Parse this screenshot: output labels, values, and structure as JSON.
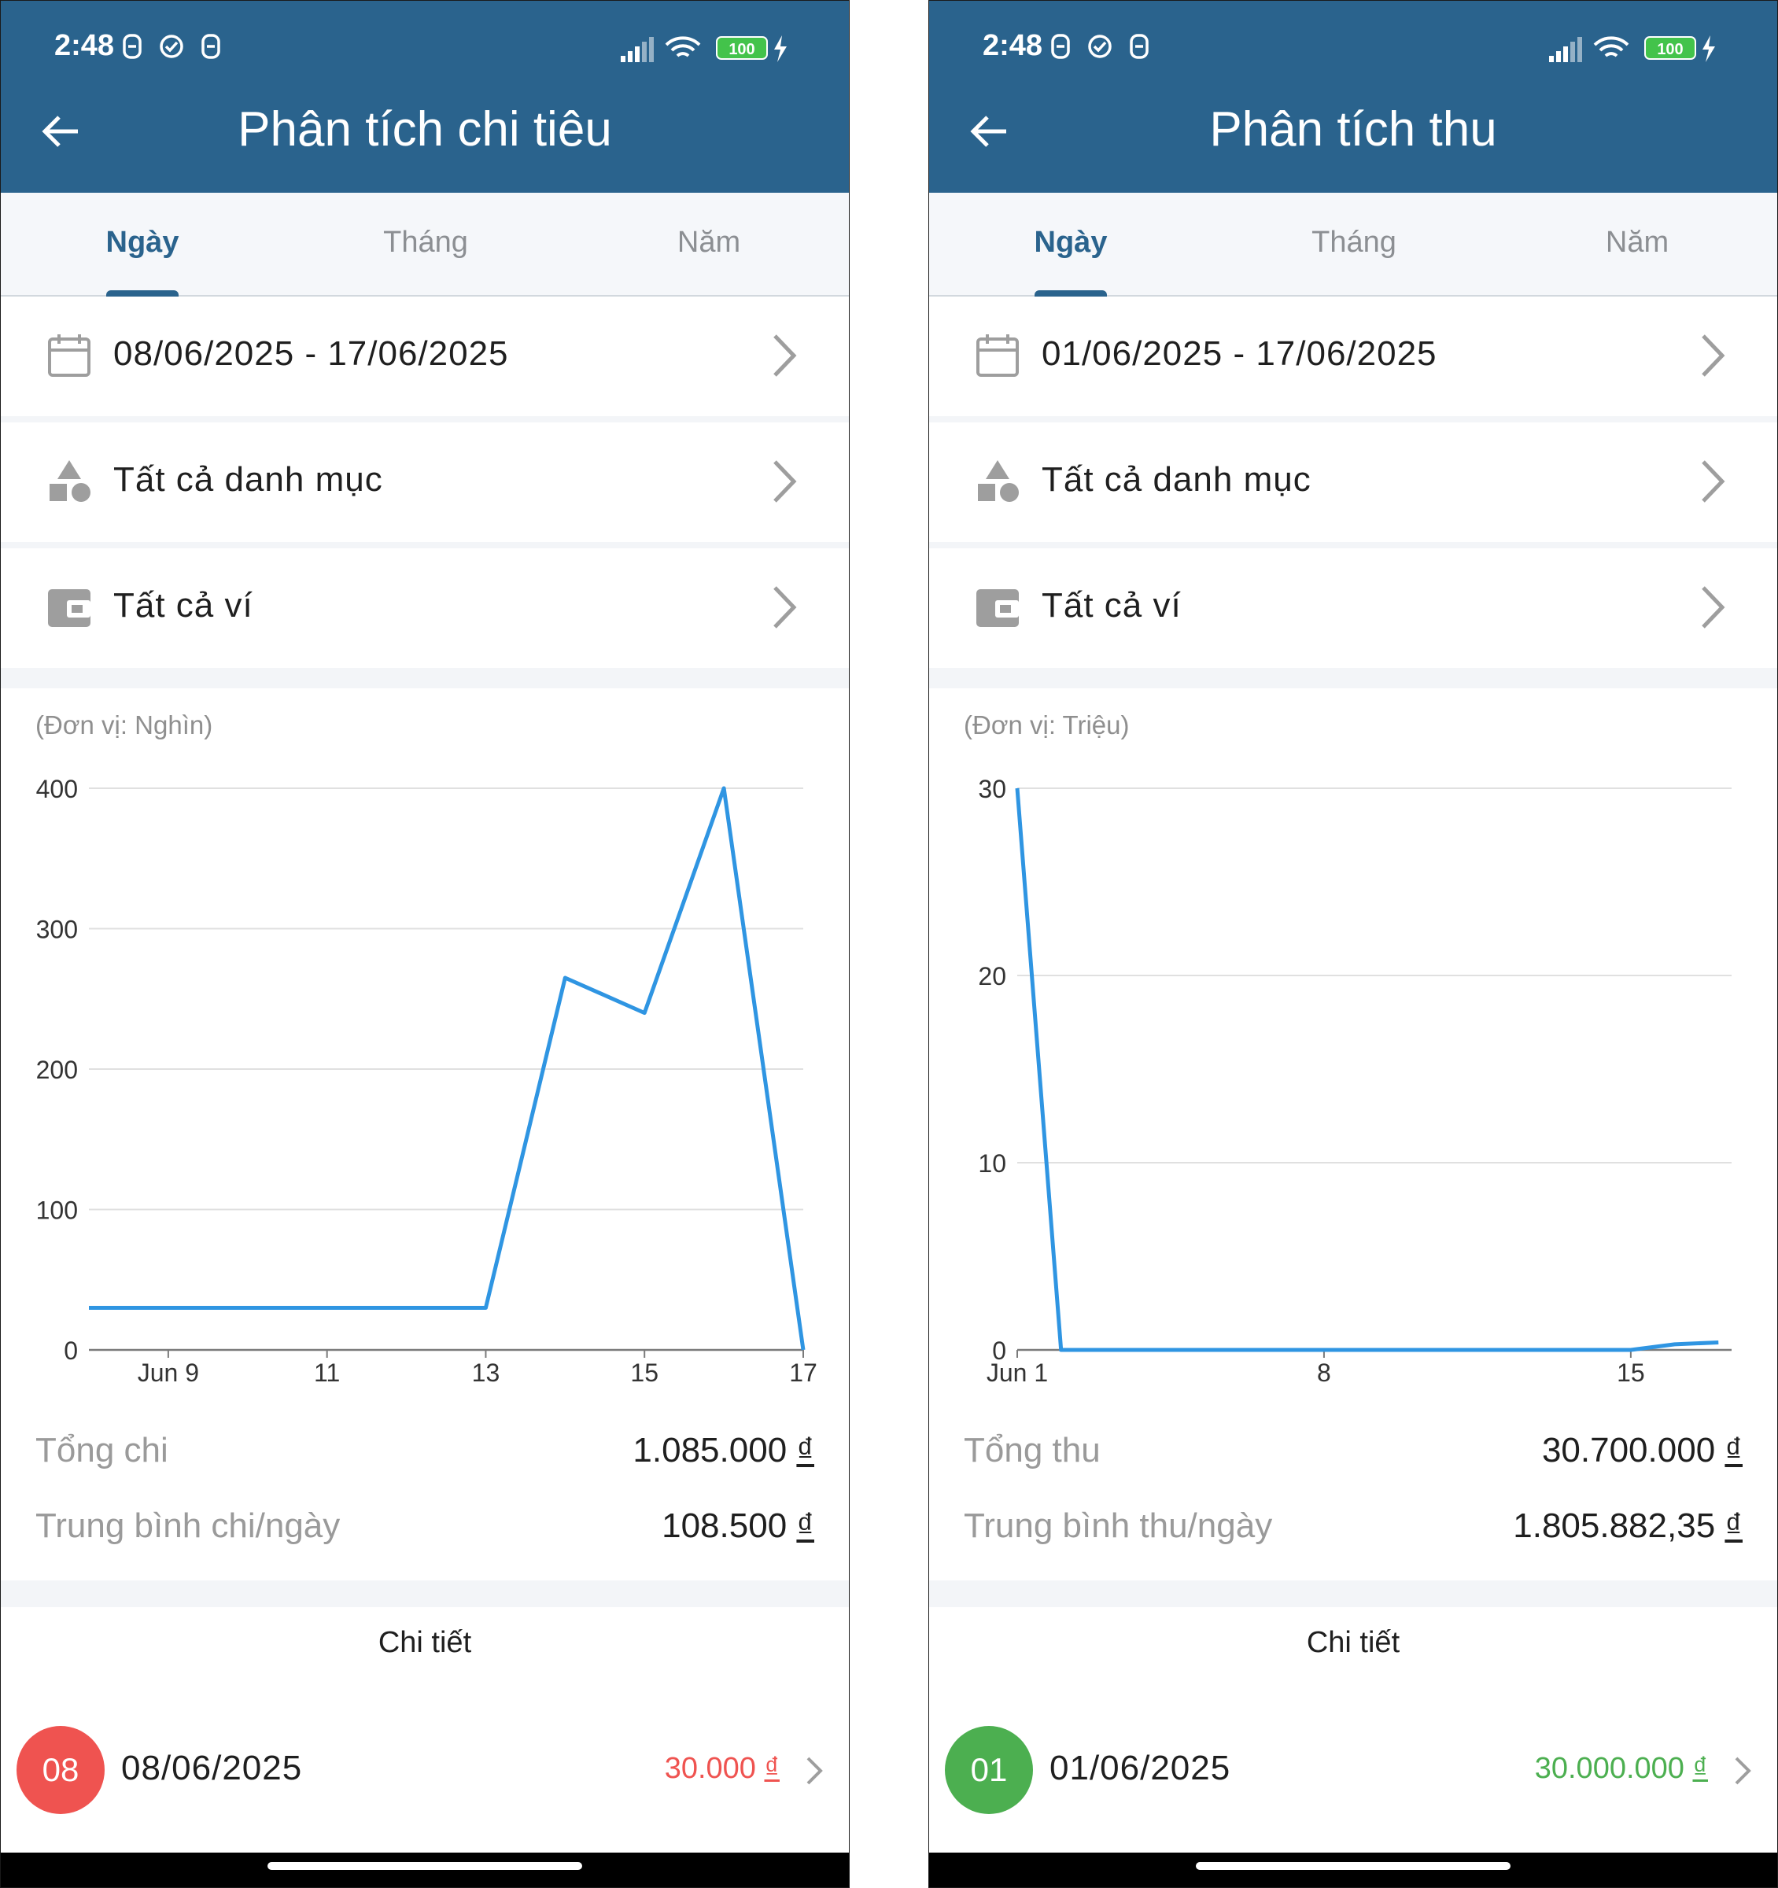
{
  "colors": {
    "appbar": "#2a638d",
    "line": "#2f95e2",
    "expense": "#ef5350",
    "income": "#4caf50",
    "grid": "#e0e0e0"
  },
  "status": {
    "time": "2:48",
    "battery": "100"
  },
  "tabs": [
    "Ngày",
    "Tháng",
    "Năm"
  ],
  "active_tab": "Ngày",
  "left": {
    "title": "Phân tích chi tiêu",
    "date_range": "08/06/2025 - 17/06/2025",
    "category": "Tất cả danh mục",
    "wallet": "Tất cả ví",
    "unit": "(Đơn vị: Nghìn)",
    "total_label": "Tổng chi",
    "total_value": "1.085.000",
    "avg_label": "Trung bình chi/ngày",
    "avg_value": "108.500",
    "currency": "₫",
    "detail": "Chi tiết",
    "entry": {
      "badge": "08",
      "date": "08/06/2025",
      "amount": "30.000",
      "color": "#ef5350"
    }
  },
  "right": {
    "title": "Phân tích thu",
    "date_range": "01/06/2025 - 17/06/2025",
    "category": "Tất cả danh mục",
    "wallet": "Tất cả ví",
    "unit": "(Đơn vị: Triệu)",
    "total_label": "Tổng thu",
    "total_value": "30.700.000",
    "avg_label": "Trung bình thu/ngày",
    "avg_value": "1.805.882,35",
    "currency": "₫",
    "detail": "Chi tiết",
    "entry": {
      "badge": "01",
      "date": "01/06/2025",
      "amount": "30.000.000",
      "color": "#4caf50"
    }
  },
  "chart_data": [
    {
      "type": "line",
      "title": "",
      "xlabel": "",
      "ylabel": "(Đơn vị: Nghìn)",
      "x": [
        8,
        9,
        10,
        11,
        12,
        13,
        14,
        15,
        16,
        17
      ],
      "series": [
        {
          "values": [
            30,
            30,
            30,
            30,
            30,
            30,
            265,
            240,
            400,
            0
          ]
        }
      ],
      "xlim": [
        8,
        17
      ],
      "xticks": [
        9,
        11,
        13,
        15,
        17
      ],
      "xtick_labels": [
        "Jun 9",
        "11",
        "13",
        "15",
        "17"
      ],
      "ylim": [
        0,
        400
      ],
      "yticks": [
        0,
        100,
        200,
        300,
        400
      ],
      "ytick_labels": [
        "0",
        "100",
        "200",
        "300",
        "400"
      ],
      "grid": true
    },
    {
      "type": "line",
      "title": "",
      "xlabel": "",
      "ylabel": "(Đơn vị: Triệu)",
      "x": [
        1,
        2,
        3,
        4,
        5,
        6,
        7,
        8,
        9,
        10,
        11,
        12,
        13,
        14,
        15,
        16,
        17
      ],
      "series": [
        {
          "values": [
            30,
            0,
            0,
            0,
            0,
            0,
            0,
            0,
            0,
            0,
            0,
            0,
            0,
            0,
            0,
            0.3,
            0.4
          ]
        }
      ],
      "xlim": [
        1,
        17.3
      ],
      "xticks": [
        1,
        8,
        15
      ],
      "xtick_labels": [
        "Jun 1",
        "8",
        "15"
      ],
      "ylim": [
        0,
        30
      ],
      "yticks": [
        0,
        10,
        20,
        30
      ],
      "ytick_labels": [
        "0",
        "10",
        "20",
        "30"
      ],
      "grid": true
    }
  ]
}
